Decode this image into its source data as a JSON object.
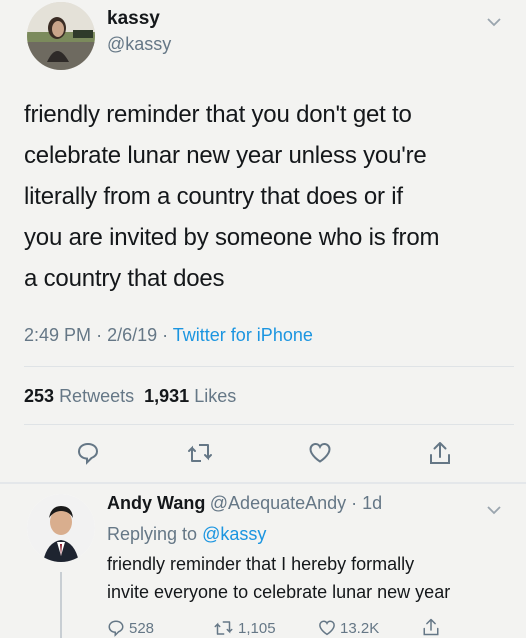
{
  "tweet": {
    "author_name": "kassy",
    "author_handle": "@kassy",
    "text_lines": [
      "friendly reminder that you don't get to",
      "celebrate lunar new year unless you're",
      "literally from a country that does or if",
      "you are invited by someone who is from",
      "a country that does"
    ],
    "time": "2:49 PM",
    "date": "2/6/19",
    "source": "Twitter for iPhone",
    "retweets_count": "253",
    "retweets_label": "Retweets",
    "likes_count": "1,931",
    "likes_label": "Likes"
  },
  "reply": {
    "author_name": "Andy Wang",
    "author_handle": "@AdequateAndy",
    "age": "1d",
    "replying_prefix": "Replying to",
    "replying_handle": "@kassy",
    "text_lines": [
      "friendly reminder that I hereby formally",
      "invite everyone to celebrate lunar new year"
    ],
    "reply_count": "528",
    "retweet_count": "1,105",
    "like_count": "13.2K"
  },
  "icons": {
    "reply": "reply-icon",
    "retweet": "retweet-icon",
    "like": "heart-icon",
    "share": "share-icon",
    "menu": "chevron-down-icon"
  },
  "colors": {
    "link": "#1b95e0",
    "secondary_text": "#657786",
    "primary_text": "#14171a"
  }
}
